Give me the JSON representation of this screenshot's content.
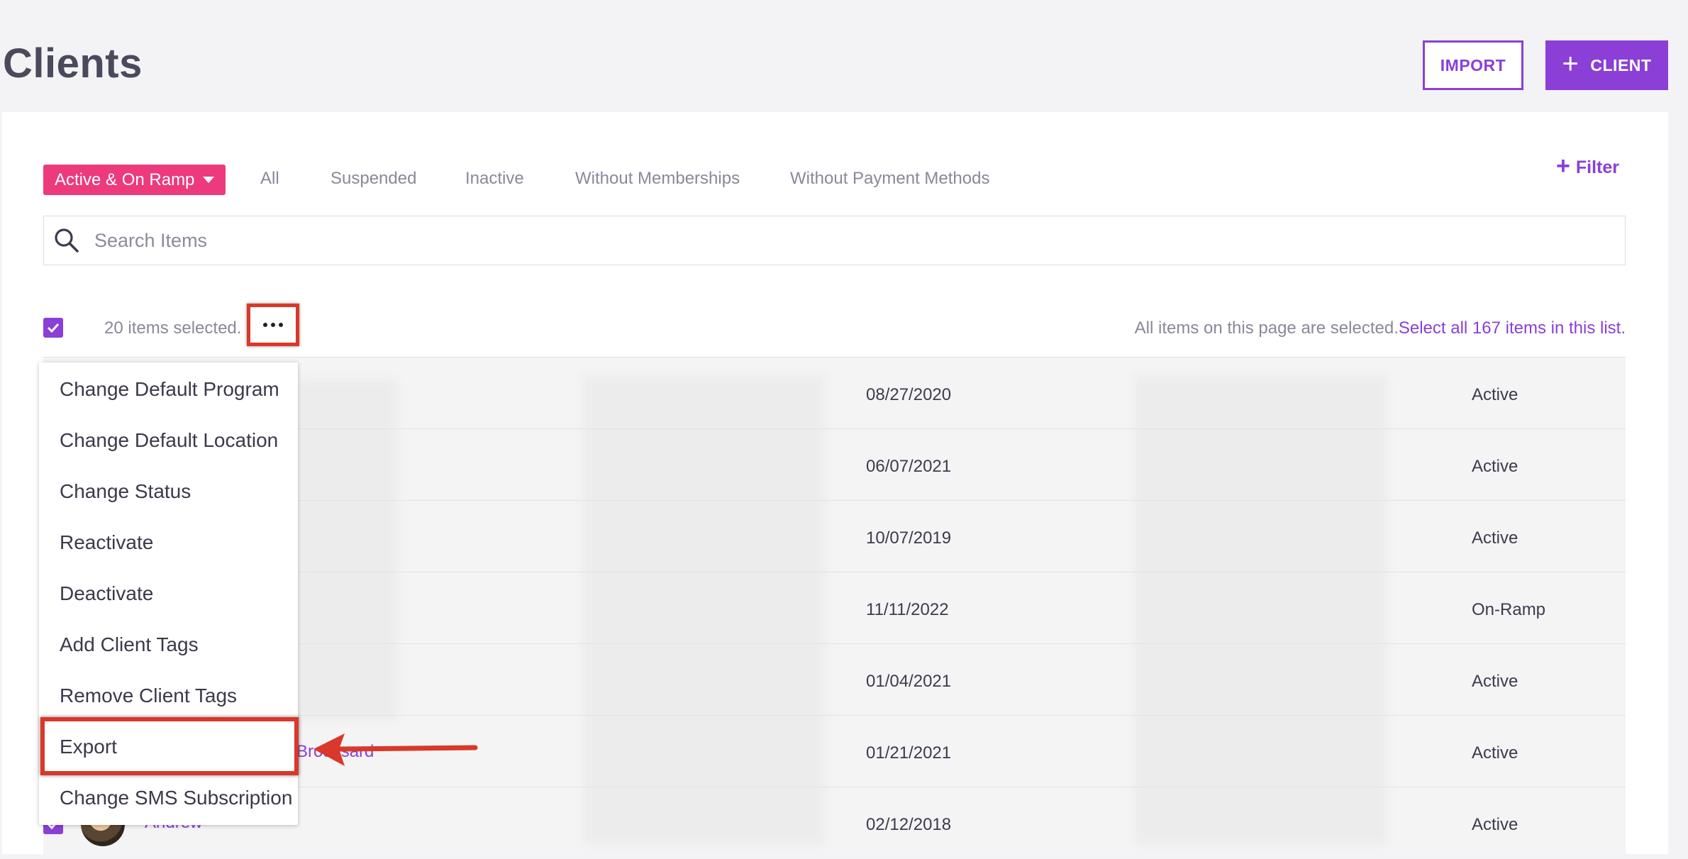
{
  "header": {
    "title": "Clients",
    "import_label": "IMPORT",
    "add_client_label": "CLIENT"
  },
  "filters": {
    "status_dropdown": "Active & On Ramp",
    "tabs": [
      "All",
      "Suspended",
      "Inactive",
      "Without Memberships",
      "Without Payment Methods"
    ],
    "filter_label": "Filter"
  },
  "search": {
    "placeholder": "Search Items",
    "value": ""
  },
  "selection": {
    "count_text": "20 items selected.",
    "page_selected_text": "All items on this page are selected.",
    "select_all_link": "Select all 167 items in this list."
  },
  "actions_menu": {
    "items": [
      "Change Default Program",
      "Change Default Location",
      "Change Status",
      "Reactivate",
      "Deactivate",
      "Add Client Tags",
      "Remove Client Tags",
      "Export",
      "Change SMS Subscription"
    ],
    "highlighted": "Export"
  },
  "table": {
    "rows": [
      {
        "date": "08/27/2020",
        "status": "Active"
      },
      {
        "date": "06/07/2021",
        "status": "Active"
      },
      {
        "date": "10/07/2019",
        "status": "Active"
      },
      {
        "date": "11/11/2022",
        "status": "On-Ramp"
      },
      {
        "date": "01/04/2021",
        "status": "Active"
      },
      {
        "date": "01/21/2021",
        "status": "Active",
        "name_partial": "Broussard"
      },
      {
        "date": "02/12/2018",
        "status": "Active",
        "name": "Andrew"
      }
    ]
  },
  "colors": {
    "brand_purple": "#8b3fd6",
    "status_pink": "#ec3a7c",
    "annotation_red": "#d9382a"
  }
}
